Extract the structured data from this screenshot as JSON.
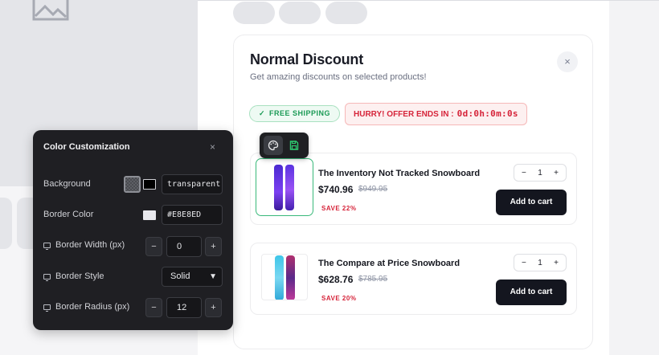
{
  "store_card": {
    "title": "Normal Discount",
    "subtitle": "Get amazing discounts on selected products!",
    "close_glyph": "×",
    "free_shipping_badge": "FREE SHIPPING",
    "offer_label": "HURRY! OFFER ENDS IN :",
    "offer_timer": "0d:0h:0m:0s",
    "products": [
      {
        "name": "The Inventory Not Tracked Snowboard",
        "price": "$740.96",
        "compare_price": "$949.95",
        "save_label": "SAVE 22%",
        "quantity": "1",
        "add_to_cart": "Add to cart"
      },
      {
        "name": "The Compare at Price Snowboard",
        "price": "$628.76",
        "compare_price": "$785.95",
        "save_label": "SAVE 20%",
        "quantity": "1",
        "add_to_cart": "Add to cart"
      }
    ]
  },
  "color_panel": {
    "title": "Color Customization",
    "close_glyph": "×",
    "background_label": "Background",
    "background_value": "transparent",
    "border_color_label": "Border Color",
    "border_color_value": "#E8E8ED",
    "border_width_label": "Border Width (px)",
    "border_width_value": "0",
    "border_style_label": "Border Style",
    "border_style_value": "Solid",
    "border_radius_label": "Border Radius (px)",
    "border_radius_value": "12",
    "minus": "−",
    "plus": "+"
  },
  "colors": {
    "accent_green": "#1a9a55",
    "accent_red": "#d6243a",
    "button_dark": "#14161f",
    "panel_bg": "#1f1f23",
    "border_color_swatch": "#E8E8ED"
  },
  "icons": {
    "toolbar_left": "palette-icon",
    "toolbar_right": "save-icon",
    "placeholder": "image-icon",
    "monitor": "monitor-icon"
  }
}
